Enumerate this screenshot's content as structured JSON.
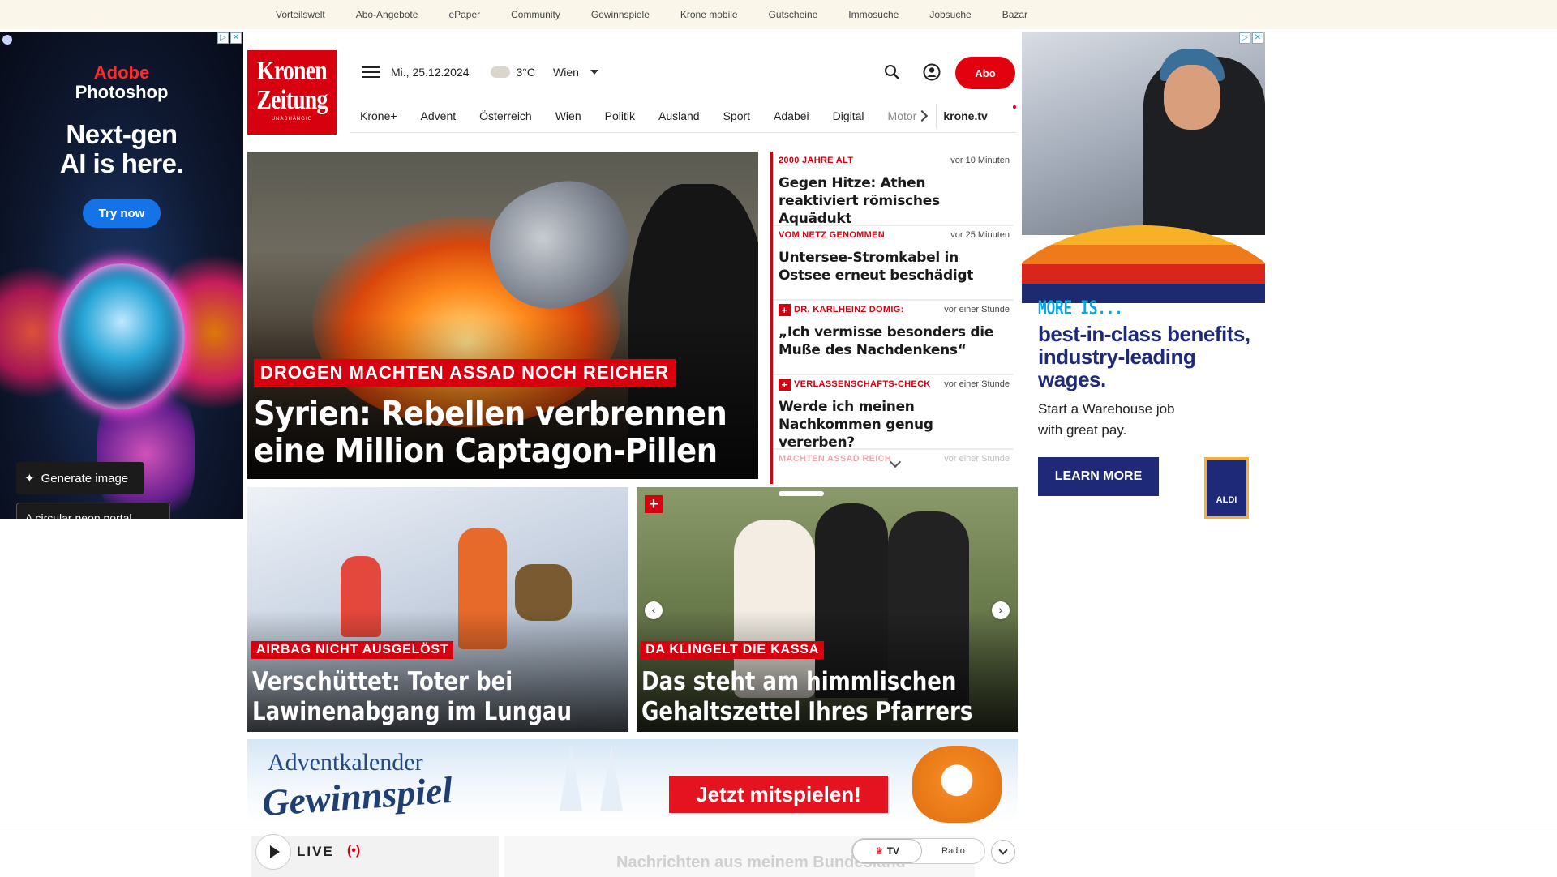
{
  "utility_nav": [
    "Vorteilswelt",
    "Abo-Angebote",
    "ePaper",
    "Community",
    "Gewinnspiele",
    "Krone mobile",
    "Gutscheine",
    "Immosuche",
    "Jobsuche",
    "Bazar"
  ],
  "logo": {
    "line1": "Kronen",
    "line2": "Zeitung",
    "tagline": "UNABHÄNGIG"
  },
  "header": {
    "date": "Mi., 25.12.2024",
    "temperature": "3°C",
    "city": "Wien",
    "abo_label": "Abo"
  },
  "nav": {
    "items": [
      "Krone+",
      "Advent",
      "Österreich",
      "Wien",
      "Politik",
      "Ausland",
      "Sport",
      "Adabei",
      "Digital"
    ],
    "faded_item": "Motor",
    "tv_label": "krone.tv"
  },
  "hero": {
    "kicker": "DROGEN MACHTEN ASSAD NOCH REICHER",
    "title_line1": "Syrien: Rebellen verbrennen",
    "title_line2": "eine Million Captagon-Pillen"
  },
  "ticker": [
    {
      "kicker": "2000 JAHRE ALT",
      "time": "vor 10 Minuten",
      "title": "Gegen Hitze: Athen reaktiviert römisches Aquädukt",
      "plus": false
    },
    {
      "kicker": "VOM NETZ GENOMMEN",
      "time": "vor 25 Minuten",
      "title": "Untersee-Stromkabel in Ostsee erneut beschädigt",
      "plus": false
    },
    {
      "kicker": "DR. KARLHEINZ DOMIG:",
      "time": "vor einer Stunde",
      "title": "„Ich vermisse besonders die Muße des Nachdenkens“",
      "plus": true
    },
    {
      "kicker": "VERLASSENSCHAFTS-CHECK",
      "time": "vor einer Stunde",
      "title": "Werde ich meinen Nachkommen genug vererben?",
      "plus": true
    },
    {
      "kicker": "MACHTEN ASSAD REICH",
      "time": "vor einer Stunde",
      "title": "",
      "plus": false
    }
  ],
  "cards": [
    {
      "kicker": "AIRBAG NICHT AUSGELÖST",
      "title_line1": "Verschüttet: Toter bei",
      "title_line2": "Lawinenabgang im Lungau"
    },
    {
      "kicker": "DA KLINGELT DIE KASSA",
      "title_line1": "Das steht am himmlischen",
      "title_line2": "Gehaltszettel Ihres Pfarrers"
    }
  ],
  "advent_banner": {
    "line1": "Adventkalender",
    "line2": "Gewinnspiel",
    "cta": "Jetzt mitspielen!"
  },
  "ad_left": {
    "brand_line1": "Adobe",
    "brand_line2": "Photoshop",
    "headline_line1": "Next-gen",
    "headline_line2": "AI is here.",
    "cta": "Try now",
    "generate_label": "Generate image",
    "prompt_text": "A circular neon portal ..."
  },
  "ad_right": {
    "more": "MORE IS...",
    "headline": "best-in-class benefits, industry-leading wages.",
    "sub": "Start a Warehouse job with great pay.",
    "cta": "LEARN MORE",
    "brand": "ALDI"
  },
  "player": {
    "live_label": "LIVE",
    "tv_label": "TV",
    "radio_label": "Radio",
    "behind_text": "Nachrichten aus meinem Bundesland"
  },
  "colors": {
    "brand_red": "#d7000f",
    "utility_bg": "#fbf6ea",
    "aldi_blue": "#1e2a78"
  }
}
